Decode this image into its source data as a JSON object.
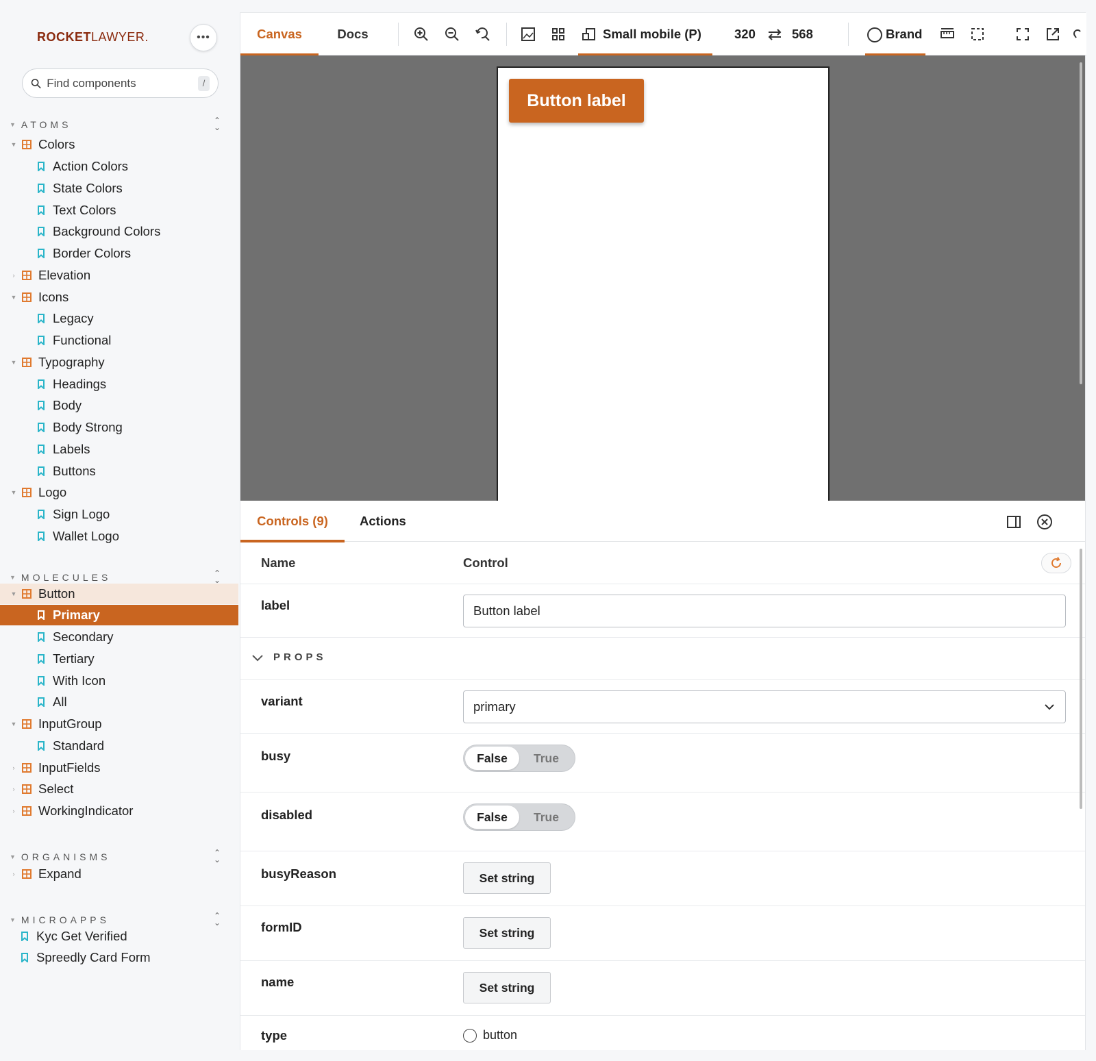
{
  "brand": {
    "logo_bold": "ROCKET",
    "logo_light": "LAWYER",
    "logo_mark": "."
  },
  "sidebar": {
    "menu_label": "•••",
    "search_placeholder": "Find components",
    "search_shortcut": "/",
    "sections": [
      {
        "title": "ATOMS"
      },
      {
        "title": "MOLECULES"
      },
      {
        "title": "ORGANISMS"
      },
      {
        "title": "MICROAPPS"
      }
    ],
    "items": [
      "Colors",
      "Action Colors",
      "State Colors",
      "Text Colors",
      "Background Colors",
      "Border Colors",
      "Elevation",
      "Icons",
      "Legacy",
      "Functional",
      "Typography",
      "Headings",
      "Body",
      "Body Strong",
      "Labels",
      "Buttons",
      "Logo",
      "Sign Logo",
      "Wallet Logo",
      "Button",
      "Primary",
      "Secondary",
      "Tertiary",
      "With Icon",
      "All",
      "InputGroup",
      "Standard",
      "InputFields",
      "Select",
      "WorkingIndicator",
      "Expand",
      "Kyc Get Verified",
      "Spreedly Card Form"
    ]
  },
  "toolbar": {
    "tab_canvas": "Canvas",
    "tab_docs": "Docs",
    "viewport": "Small mobile (P)",
    "width": "320",
    "height": "568",
    "brand": "Brand"
  },
  "preview": {
    "button_label": "Button label"
  },
  "addons": {
    "tab_controls": "Controls (9)",
    "tab_actions": "Actions",
    "col_name": "Name",
    "col_control": "Control",
    "props_label": "PROPS",
    "label": {
      "name": "label",
      "value": "Button label"
    },
    "variant": {
      "name": "variant",
      "value": "primary"
    },
    "busy": {
      "name": "busy",
      "false_label": "False",
      "true_label": "True"
    },
    "disabled": {
      "name": "disabled",
      "false_label": "False",
      "true_label": "True"
    },
    "busyReason": {
      "name": "busyReason",
      "button": "Set string"
    },
    "formID": {
      "name": "formID",
      "button": "Set string"
    },
    "nameProp": {
      "name": "name",
      "button": "Set string"
    },
    "type": {
      "name": "type",
      "option": "button"
    }
  },
  "colors": {
    "accent": "#c96520",
    "brand_red": "#8a2a0e",
    "story_icon": "#2ab5c9",
    "component_icon": "#e07a2f"
  }
}
